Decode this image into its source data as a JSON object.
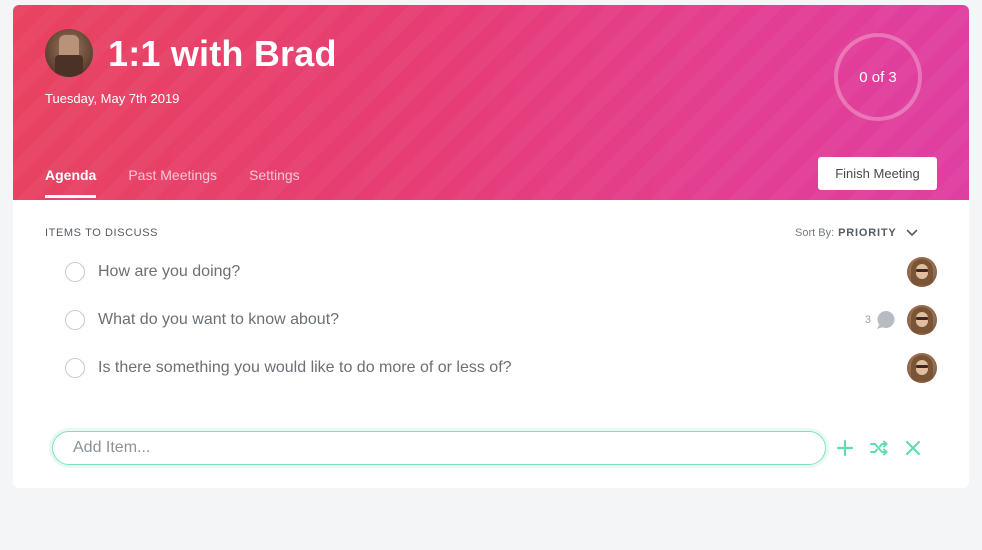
{
  "meeting": {
    "title": "1:1 with Brad",
    "date": "Tuesday, May 7th 2019",
    "progress_text": "0 of 3",
    "progress_done": 0,
    "progress_total": 3
  },
  "tabs": [
    {
      "label": "Agenda",
      "active": true
    },
    {
      "label": "Past Meetings",
      "active": false
    },
    {
      "label": "Settings",
      "active": false
    }
  ],
  "finish_button": "Finish Meeting",
  "agenda": {
    "section_label": "ITEMS TO DISCUSS",
    "sort_prefix": "Sort By:",
    "sort_value": "PRIORITY",
    "items": [
      {
        "text": "How are you doing?",
        "comment_count": ""
      },
      {
        "text": "What do you want to know about?",
        "comment_count": "3"
      },
      {
        "text": "Is there something you would like to do more of or less of?",
        "comment_count": ""
      }
    ]
  },
  "add_item": {
    "placeholder": "Add Item...",
    "value": ""
  },
  "icons": {
    "add": "plus-icon",
    "shuffle": "shuffle-icon",
    "cancel": "close-icon",
    "sort": "chevron-down-icon",
    "comment": "comment-bubble-icon"
  },
  "colors": {
    "header_start": "#e8435f",
    "header_end": "#df3fa3",
    "accent_teal": "#5fdcb5",
    "text_muted": "#6b7075"
  }
}
